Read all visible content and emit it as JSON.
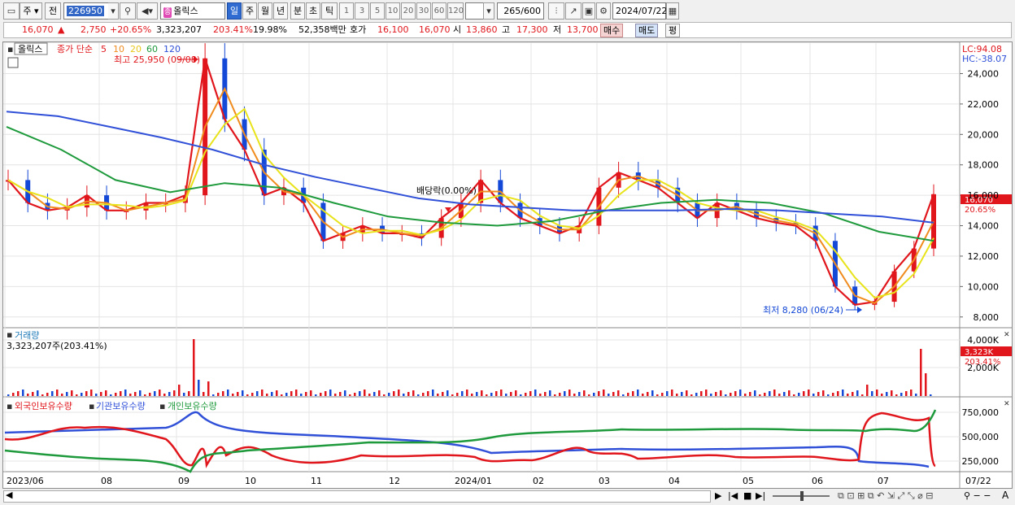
{
  "toolbar": {
    "frame_icon": "window-icon",
    "type_select": "주",
    "prev_label": "전",
    "code_value": "226950",
    "search_icon": "magnifier-icon",
    "speaker_icon": "speaker-icon",
    "stock_tag": "종",
    "stock_name": "올릭스",
    "periods": [
      "일",
      "주",
      "월",
      "년",
      "분",
      "초",
      "틱"
    ],
    "active_period": "일",
    "intervals": [
      "1",
      "3",
      "5",
      "10",
      "20",
      "30",
      "60",
      "120"
    ],
    "count_value": "265",
    "count_total": "/600",
    "date_value": "2024/07/22"
  },
  "quote": {
    "price": "16,070",
    "change": "2,750",
    "change_pct": "+20.65%",
    "volume": "3,323,207",
    "volume_ratio": "203.41%",
    "turnover": "19.98%",
    "amount": "52,358백만",
    "hoga_label": "호가",
    "ask": "16,100",
    "bid": "16,070",
    "open_label": "시",
    "open": "13,860",
    "high_label": "고",
    "high": "17,300",
    "low_label": "저",
    "low": "13,700",
    "buy_label": "매수",
    "sell_label": "매도",
    "eval_label": "평"
  },
  "price_panel": {
    "legend_name": "올릭스",
    "legend_type": "종가 단순",
    "ma_periods": [
      "5",
      "10",
      "20",
      "60",
      "120"
    ],
    "ma_colors": [
      "#e0161c",
      "#f08c1e",
      "#e8e31a",
      "#1e9a3c",
      "#3050d8"
    ],
    "lc": "LC:94.08",
    "hc": "HC:-38.07",
    "high_note": "최고 25,950 (09/08)",
    "low_note": "최저 8,280 (06/24)",
    "dividend_note": "배당락(0.00%)",
    "current_price_tag": "16,070",
    "current_pct_tag": "20.65%",
    "y_ticks": [
      "24,000",
      "22,000",
      "20,000",
      "18,000",
      "16,000",
      "14,000",
      "12,000",
      "10,000",
      "8,000"
    ]
  },
  "volume_panel": {
    "title": "거래량",
    "value_text": "3,323,207주(203.41%)",
    "y_ticks": [
      "4,000K",
      "2,000K"
    ],
    "tag_value": "3,323K",
    "tag_pct": "203.41%"
  },
  "holding_panel": {
    "legend": [
      "외국인보유수량",
      "기관보유수량",
      "개인보유수량"
    ],
    "legend_colors": [
      "#e0161c",
      "#3050d8",
      "#1e9a3c"
    ],
    "y_ticks": [
      "750,000",
      "500,000",
      "250,000"
    ]
  },
  "x_axis": {
    "labels": [
      "2023/06",
      "08",
      "09",
      "10",
      "11",
      "12",
      "2024/01",
      "02",
      "03",
      "04",
      "05",
      "06",
      "07"
    ],
    "end_label": "07/22"
  },
  "chart_data": {
    "type": "line",
    "x_domain": [
      "2023/06",
      "2024/07/22"
    ],
    "price_ylim": [
      7400,
      25950
    ],
    "price_close_series_approx": [
      17000,
      15500,
      15000,
      15200,
      16000,
      15000,
      15000,
      15500,
      15500,
      16000,
      25000,
      21000,
      19000,
      16000,
      16500,
      15500,
      13000,
      13500,
      14000,
      13500,
      13500,
      13200,
      14500,
      15500,
      17000,
      15500,
      14500,
      14000,
      13500,
      14000,
      16500,
      17500,
      17000,
      16500,
      15500,
      14500,
      15500,
      15000,
      14500,
      14200,
      14000,
      13000,
      10000,
      8800,
      9000,
      11000,
      12500,
      16070
    ],
    "ma120_approx": [
      21500,
      21200,
      20500,
      19800,
      19000,
      18000,
      17200,
      16500,
      15800,
      15400,
      15200,
      15000,
      15000,
      15000,
      15100,
      15000,
      14800,
      14600,
      14200
    ],
    "ma60_approx": [
      20500,
      19000,
      17000,
      16200,
      16800,
      16500,
      15500,
      14600,
      14200,
      14000,
      14300,
      15000,
      15500,
      15700,
      15500,
      14800,
      13600,
      13000
    ],
    "holding_ylim": [
      150000,
      850000
    ]
  }
}
